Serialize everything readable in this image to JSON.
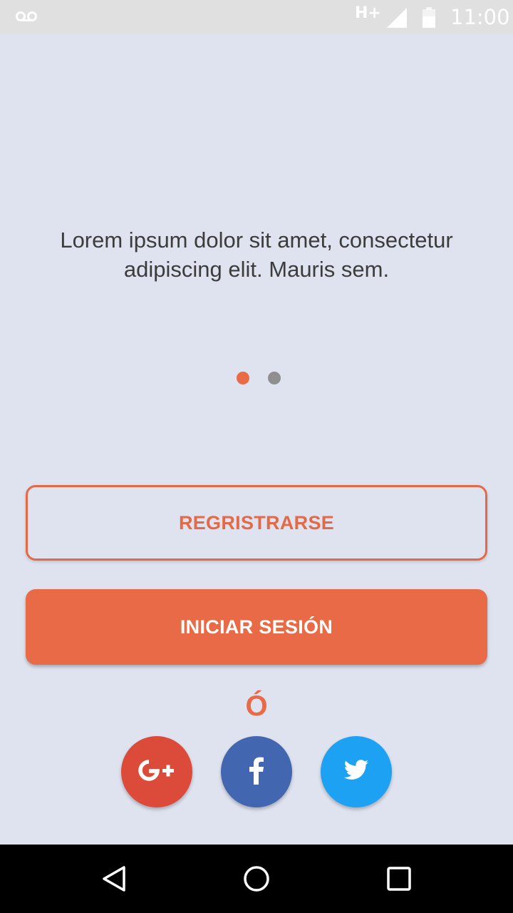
{
  "status_bar": {
    "network": "H+",
    "time": "11:00",
    "icons": [
      "voicemail-icon",
      "signal-icon",
      "battery-icon"
    ]
  },
  "intro": {
    "text": "Lorem ipsum dolor sit amet, consectetur adipiscing elit. Mauris sem."
  },
  "pager": {
    "pages": 2,
    "active_index": 0
  },
  "actions": {
    "register_label": "REGRISTRARSE",
    "login_label": "INICIAR SESIÓN",
    "or_label": "Ó"
  },
  "social": {
    "google_label": "G+",
    "facebook_label": "f",
    "twitter_label": "twitter"
  },
  "colors": {
    "accent": "#e96a46",
    "background": "#dfe3ef",
    "google": "#dc4a39",
    "facebook": "#4366b0",
    "twitter": "#1da1f2"
  },
  "nav_bar": {
    "icons": [
      "back-icon",
      "home-icon",
      "recent-apps-icon"
    ]
  }
}
